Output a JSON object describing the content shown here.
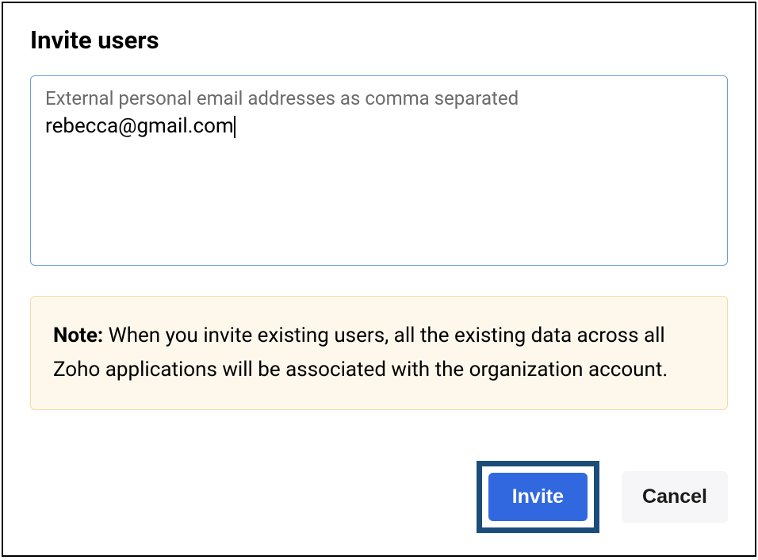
{
  "dialog": {
    "title": "Invite users",
    "email_field": {
      "label": "External personal email addresses as comma separated",
      "value": "rebecca@gmail.com"
    },
    "note": {
      "prefix": "Note:",
      "text": " When you invite existing users, all the existing data across all Zoho applications will be associated with the organization account."
    },
    "buttons": {
      "invite": "Invite",
      "cancel": "Cancel"
    }
  }
}
